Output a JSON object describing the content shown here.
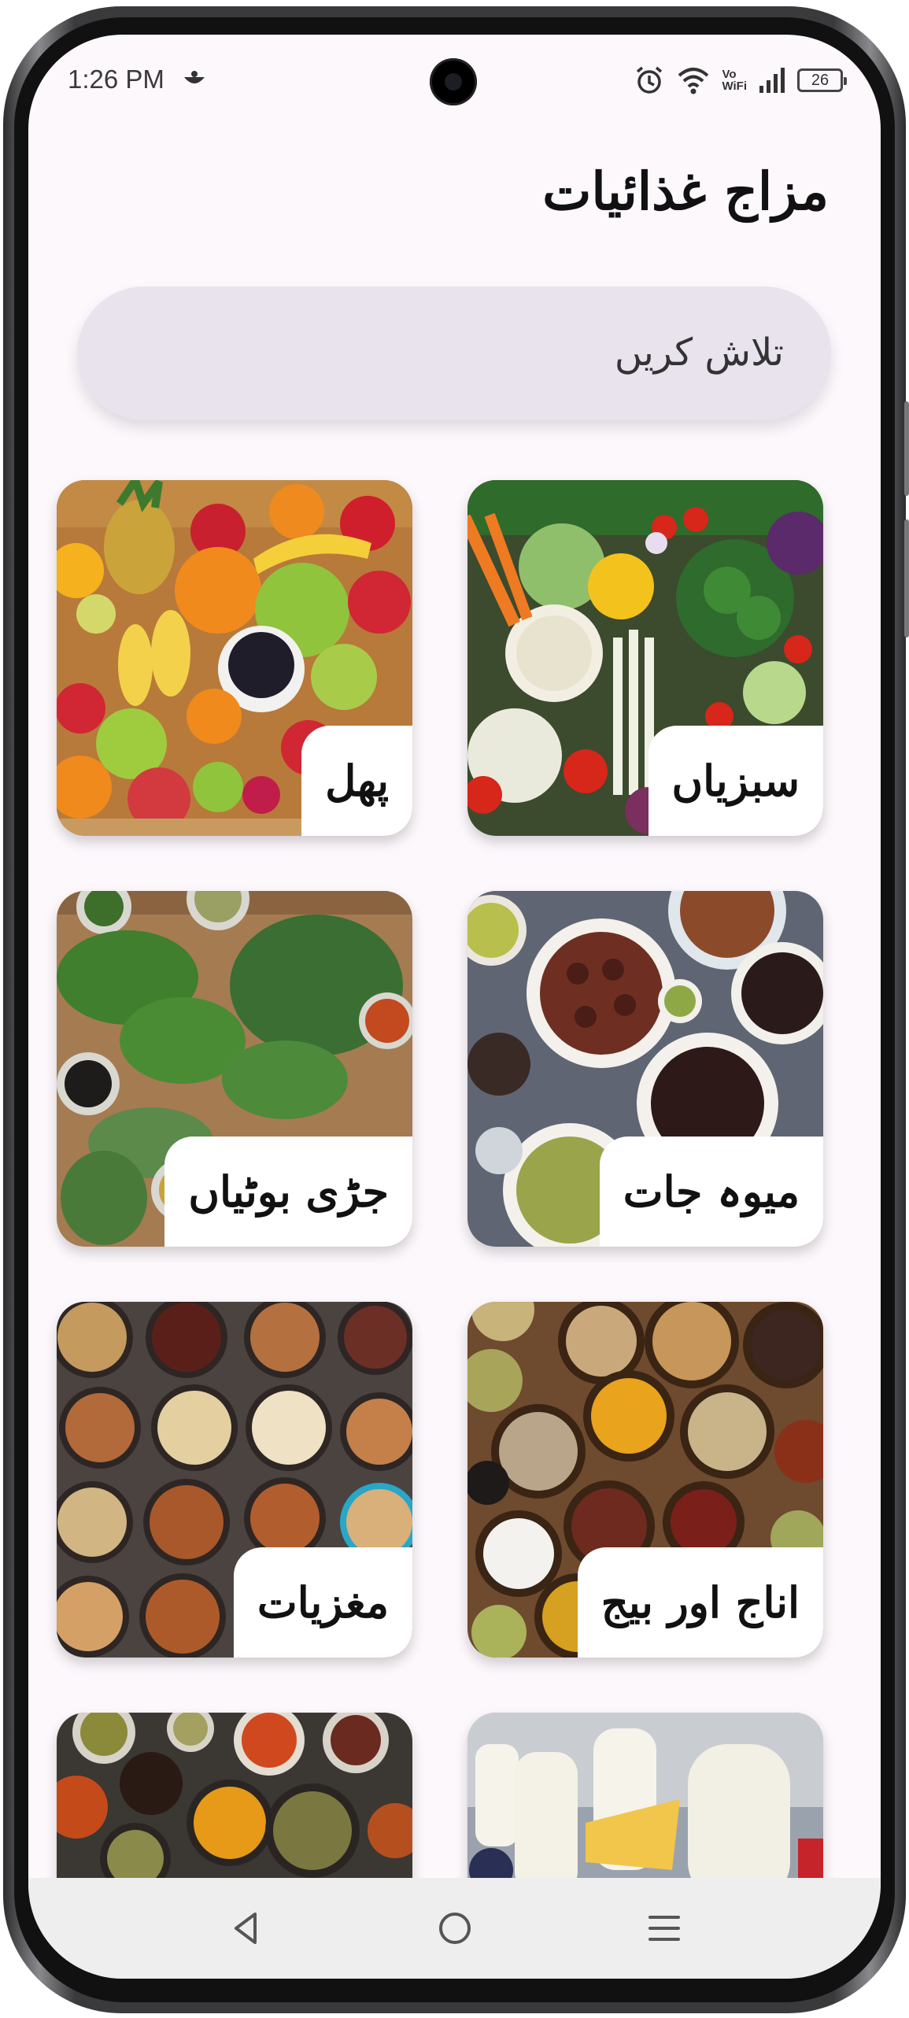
{
  "status_bar": {
    "time": "1:26 PM",
    "battery": "26",
    "vowifi_top": "Vo",
    "vowifi_bottom": "WiFi",
    "icons": [
      "app-notification-icon",
      "alarm-icon",
      "wifi-icon",
      "vowifi-icon",
      "signal-icon",
      "battery-icon"
    ]
  },
  "app": {
    "title": "مزاج غذائیات"
  },
  "search": {
    "placeholder": "تلاش کریں"
  },
  "categories": [
    {
      "label": "سبزیاں",
      "image": "vegetables"
    },
    {
      "label": "پھل",
      "image": "fruits"
    },
    {
      "label": "میوہ جات",
      "image": "dried-fruits"
    },
    {
      "label": "جڑی بوٹیاں",
      "image": "herbs"
    },
    {
      "label": "اناج اور بیج",
      "image": "grains-and-seeds"
    },
    {
      "label": "مغزیات",
      "image": "nuts"
    },
    {
      "label": "",
      "image": "dairy"
    },
    {
      "label": "",
      "image": "spices"
    }
  ],
  "nav": {
    "icons": [
      "back-icon",
      "home-icon",
      "menu-icon"
    ]
  },
  "colors": {
    "screen_bg": "#fdf8fc",
    "search_bg": "#e9e3ee",
    "card_label_bg": "#ffffff",
    "navbar_bg": "#efeeef"
  }
}
